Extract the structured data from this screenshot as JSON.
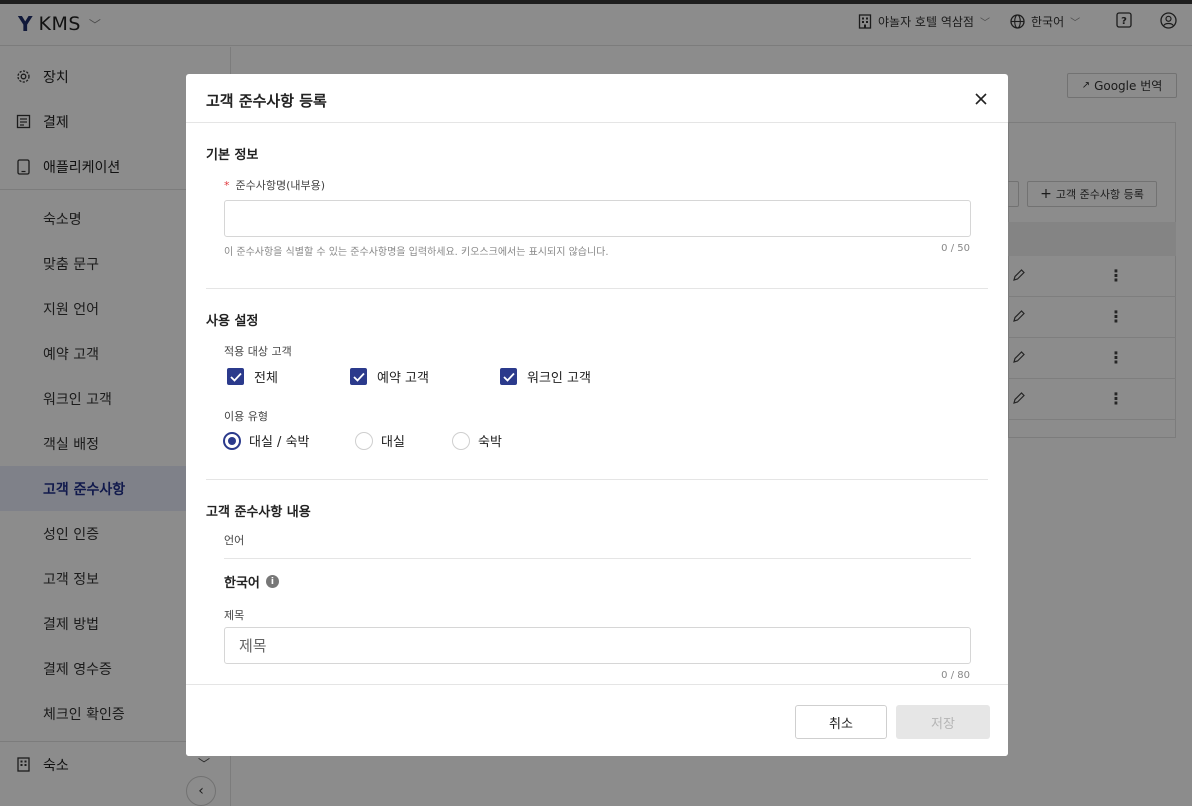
{
  "topbar": {
    "app_name": "KMS",
    "property": "야놀자 호텔 역삼점",
    "language": "한국어"
  },
  "sidebar": {
    "top_items": [
      {
        "label": "장치"
      },
      {
        "label": "결제"
      },
      {
        "label": "애플리케이션"
      }
    ],
    "sub_items": [
      {
        "label": "숙소명"
      },
      {
        "label": "맞춤 문구"
      },
      {
        "label": "지원 언어"
      },
      {
        "label": "예약 고객"
      },
      {
        "label": "워크인 고객"
      },
      {
        "label": "객실 배정"
      },
      {
        "label": "고객 준수사항",
        "active": true
      },
      {
        "label": "성인 인증"
      },
      {
        "label": "고객 정보"
      },
      {
        "label": "결제 방법"
      },
      {
        "label": "결제 영수증"
      },
      {
        "label": "체크인 확인증"
      }
    ],
    "bottom_items": [
      {
        "label": "숙소"
      }
    ]
  },
  "background": {
    "google_translate_label": "Google 번역",
    "add_button_label": "고객 준수사항 등록"
  },
  "modal": {
    "title": "고객 준수사항 등록",
    "basic": {
      "section_title": "기본 정보",
      "name_label": "준수사항명(내부용)",
      "name_value": "",
      "name_help": "이 준수사항을 식별할 수 있는 준수사항명을 입력하세요. 키오스크에서는 표시되지 않습니다.",
      "name_counter": "0 / 50"
    },
    "usage": {
      "section_title": "사용 설정",
      "target_label": "적용 대상 고객",
      "targets": [
        {
          "label": "전체",
          "checked": true
        },
        {
          "label": "예약 고객",
          "checked": true
        },
        {
          "label": "워크인 고객",
          "checked": true
        }
      ],
      "type_label": "이용 유형",
      "types": [
        {
          "label": "대실 / 숙박",
          "selected": true
        },
        {
          "label": "대실",
          "selected": false
        },
        {
          "label": "숙박",
          "selected": false
        }
      ]
    },
    "content": {
      "section_title": "고객 준수사항 내용",
      "language_tab_label": "언어",
      "language_name": "한국어",
      "title_label": "제목",
      "title_placeholder": "제목",
      "title_counter": "0 / 80"
    },
    "footer": {
      "cancel_label": "취소",
      "save_label": "저장"
    }
  },
  "colors": {
    "accent": "#2b3a8c",
    "required": "#e0393e",
    "active_nav_bg": "#e8ecf9"
  }
}
